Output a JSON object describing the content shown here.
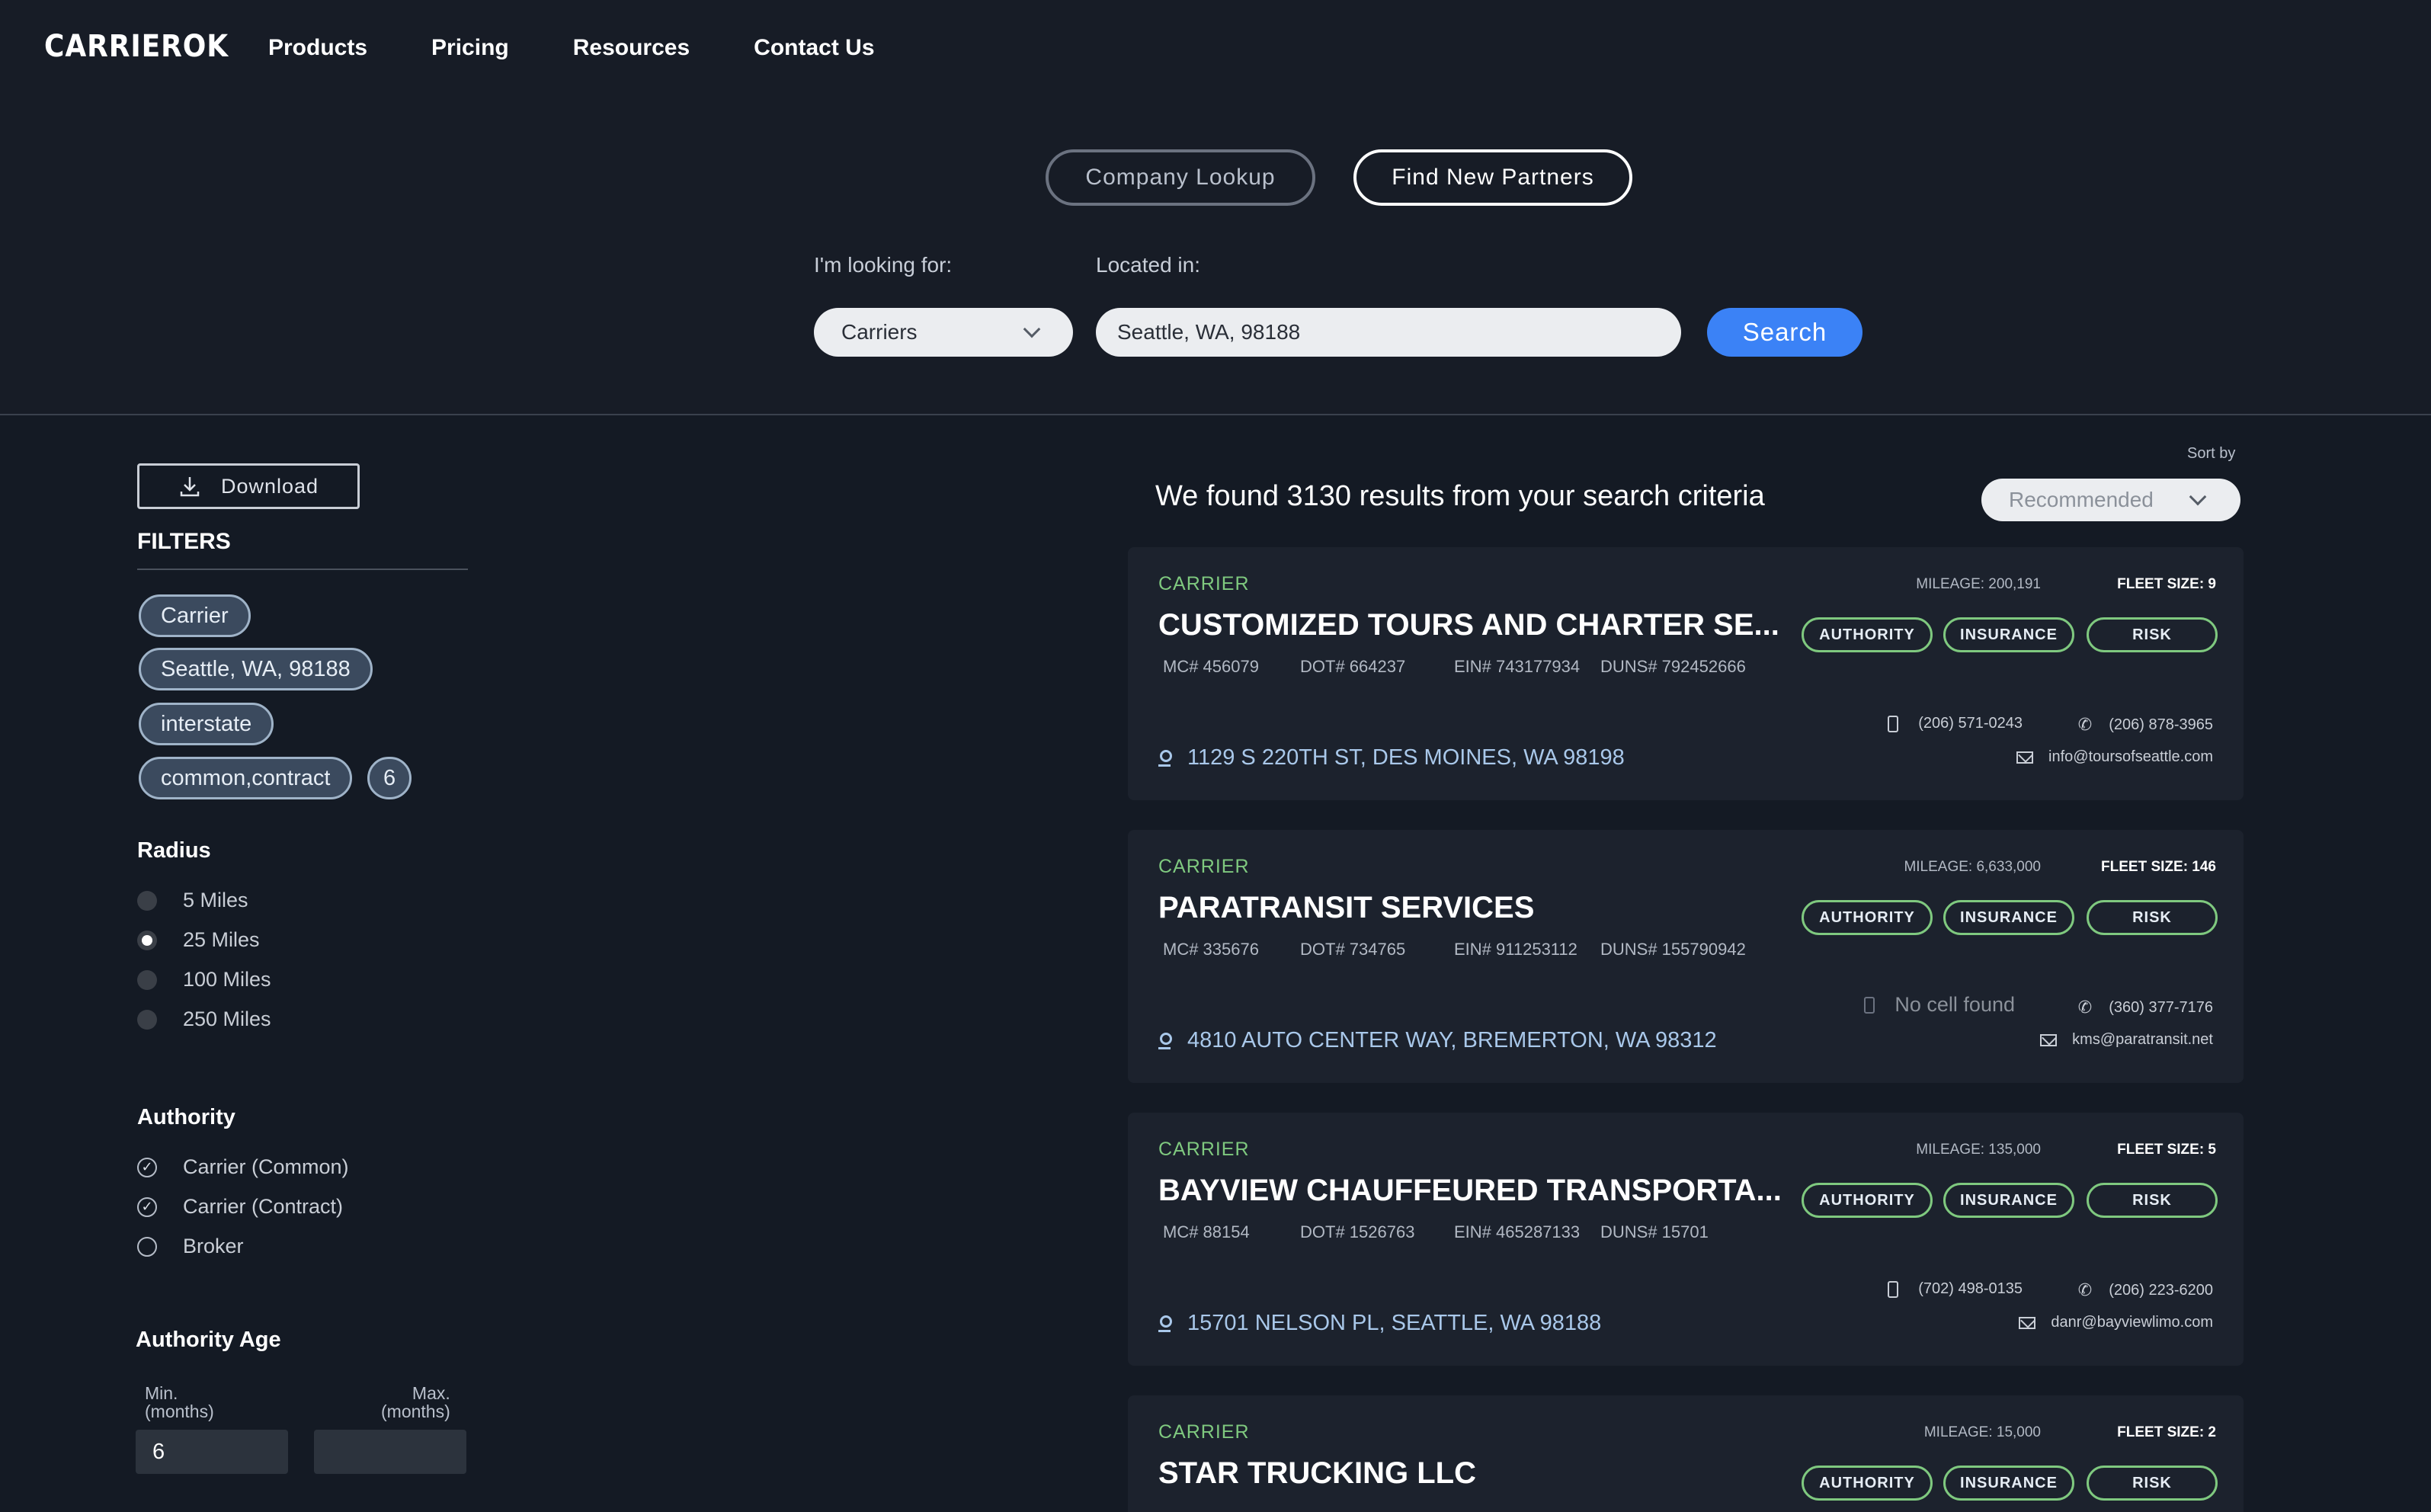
{
  "header": {
    "logo": "CARRIEROK",
    "nav": [
      "Products",
      "Pricing",
      "Resources",
      "Contact Us"
    ]
  },
  "search": {
    "mode_lookup": "Company Lookup",
    "mode_partners": "Find New Partners",
    "looking_label": "I'm looking for:",
    "located_label": "Located in:",
    "looking_value": "Carriers",
    "location_value": "Seattle, WA, 98188",
    "search_label": "Search"
  },
  "sidebar": {
    "download_label": "Download",
    "filters_title": "FILTERS",
    "chips": [
      "Carrier",
      "Seattle, WA, 98188",
      "interstate",
      "common,contract",
      "6"
    ],
    "radius_title": "Radius",
    "radius_options": [
      "5 Miles",
      "25 Miles",
      "100 Miles",
      "250 Miles"
    ],
    "radius_selected": "25 Miles",
    "authority_title": "Authority",
    "authority_options": [
      "Carrier (Common)",
      "Carrier (Contract)",
      "Broker"
    ],
    "authority_age_title": "Authority Age",
    "min_label_1": "Min.",
    "min_label_2": "(months)",
    "max_label_1": "Max.",
    "max_label_2": "(months)",
    "min_value": "6",
    "max_value": ""
  },
  "results": {
    "summary": "We found 3130 results from your search criteria",
    "sort_by_label": "Sort by",
    "sort_value": "Recommended",
    "tag_authority": "AUTHORITY",
    "tag_insurance": "INSURANCE",
    "tag_risk": "RISK",
    "cards": [
      {
        "type": "CARRIER",
        "name": "CUSTOMIZED TOURS AND CHARTER SE...",
        "mileage": "MILEAGE: 200,191",
        "fleet": "FLEET SIZE: 9",
        "mc": "MC# 456079",
        "dot": "DOT# 664237",
        "ein": "EIN# 743177934",
        "duns": "DUNS# 792452666",
        "cell": "(206) 571-0243",
        "phone": "(206) 878-3965",
        "email": "info@toursofseattle.com",
        "address": "1129 S 220TH ST, DES MOINES, WA 98198"
      },
      {
        "type": "CARRIER",
        "name": "PARATRANSIT SERVICES",
        "mileage": "MILEAGE: 6,633,000",
        "fleet": "FLEET SIZE: 146",
        "mc": "MC# 335676",
        "dot": "DOT# 734765",
        "ein": "EIN# 911253112",
        "duns": "DUNS# 155790942",
        "cell": "No cell found",
        "phone": "(360) 377-7176",
        "email": "kms@paratransit.net",
        "address": "4810 AUTO CENTER WAY, BREMERTON, WA 98312"
      },
      {
        "type": "CARRIER",
        "name": "BAYVIEW CHAUFFEURED TRANSPORTA...",
        "mileage": "MILEAGE: 135,000",
        "fleet": "FLEET SIZE: 5",
        "mc": "MC# 88154",
        "dot": "DOT# 1526763",
        "ein": "EIN# 465287133",
        "duns": "DUNS# 15701",
        "cell": "(702) 498-0135",
        "phone": "(206) 223-6200",
        "email": "danr@bayviewlimo.com",
        "address": "15701 NELSON PL, SEATTLE, WA 98188"
      },
      {
        "type": "CARRIER",
        "name": "STAR TRUCKING LLC",
        "mileage": "MILEAGE: 15,000",
        "fleet": "FLEET SIZE: 2"
      }
    ]
  },
  "colors": {
    "background": "#141a24",
    "card": "#1c222d",
    "accent_blue": "#3b82f6",
    "carrier_green": "#7fc97f",
    "address_blue": "#a9c8ea"
  },
  "icons": [
    "download-icon",
    "chevron-down-icon",
    "map-pin-icon",
    "cell-phone-icon",
    "phone-icon",
    "mail-icon",
    "check-circle-icon"
  ]
}
